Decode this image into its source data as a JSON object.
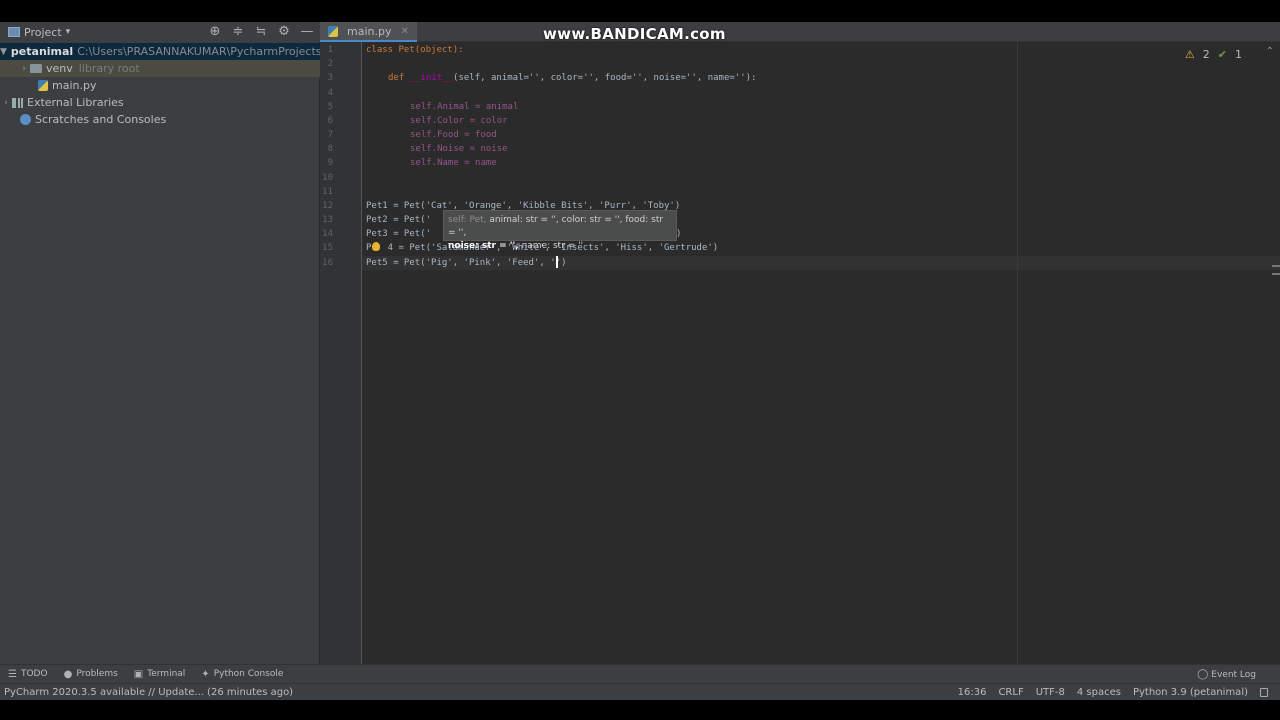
{
  "watermark": "www.BANDICAM.com",
  "project_panel": {
    "title": "Project",
    "header_icons": [
      "target-icon",
      "expand-all-icon",
      "collapse-all-icon",
      "gear-icon",
      "minimize-icon"
    ],
    "tree": {
      "root_name": "petanimal",
      "root_path": "C:\\Users\\PRASANNAKUMAR\\PycharmProjects\\petan",
      "venv_name": "venv",
      "venv_note": "library root",
      "file_main": "main.py",
      "external_libraries": "External Libraries",
      "scratches": "Scratches and Consoles"
    }
  },
  "editor": {
    "tab_label": "main.py",
    "inspection": {
      "warnings": "2",
      "ok": "1"
    },
    "line_numbers": [
      "1",
      "2",
      "3",
      "4",
      "5",
      "6",
      "7",
      "8",
      "9",
      "10",
      "11",
      "12",
      "13",
      "14",
      "15",
      "16"
    ],
    "code": {
      "l1": "class Pet(object):",
      "l3_def": "def ",
      "l3_init": "__init__",
      "l3_params": "(self, animal='', color='', food='', noise='', name=''):",
      "l5": "self.Animal = animal",
      "l6": "self.Color = color",
      "l7": "self.Food = food",
      "l8": "self.Noise = noise",
      "l9": "self.Name = name",
      "l12": "Pet1 = Pet('Cat', 'Orange', 'Kibble Bits', 'Purr', 'Toby')",
      "l13": "Pet2 = Pet('",
      "l14": "Pet3 = Pet('",
      "l14_tail": ")",
      "l15": "P   4 = Pet('Salamander', 'White', 'Insects', 'Hiss', 'Gertrude')",
      "l16": "Pet5 = Pet('Pig', 'Pink', 'Feed', '')"
    },
    "tooltip": {
      "line1_faint": "self: Pet,",
      "line1": " animal: str = '', color: str = '', food: str = '',",
      "line2_bold": "noise: str = '',",
      "line2": " name: str = ''"
    }
  },
  "tool_windows": {
    "todo": "TODO",
    "problems": "Problems",
    "terminal": "Terminal",
    "python_console": "Python Console",
    "event_log": "Event Log"
  },
  "status_bar": {
    "message": "PyCharm 2020.3.5 available // Update... (26 minutes ago)",
    "position": "16:36",
    "line_sep": "CRLF",
    "encoding": "UTF-8",
    "indent": "4 spaces",
    "interpreter": "Python 3.9 (petanimal)"
  }
}
